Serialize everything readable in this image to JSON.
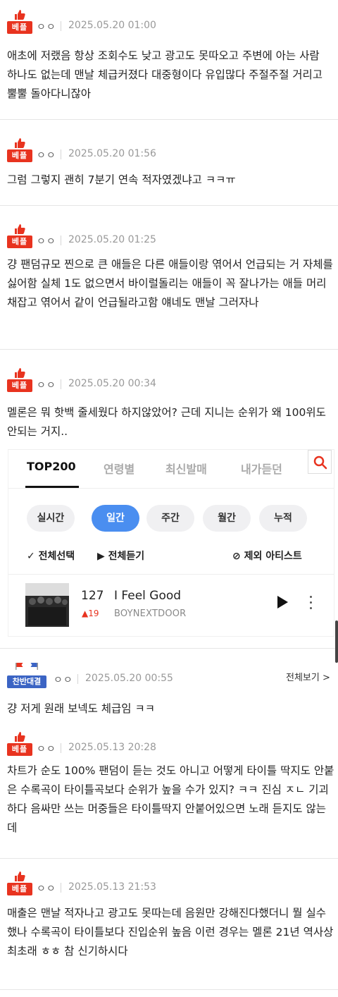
{
  "badges": {
    "best": "베플",
    "debate": "찬반대결"
  },
  "comments": [
    {
      "author": "ㅇㅇ",
      "date": "2025.05.20 01:00",
      "text": "애초에 저랬음 항상 조회수도 낮고 광고도 못따오고 주변에 아는 사람 하나도 없는데 맨날 체급커졌다 대중형이다 유입많다 주절주절 거리고 뿔뿔 돌아다니잖아"
    },
    {
      "author": "ㅇㅇ",
      "date": "2025.05.20 01:56",
      "text": "그럼 그렇지 괜히 7분기 연속 적자였겠냐고 ㅋㅋㅠ"
    },
    {
      "author": "ㅇㅇ",
      "date": "2025.05.20 01:25",
      "text": "걍 팬덤규모 찐으로 큰 애들은 다른 애들이랑 엮어서 언급되는 거 자체를 싫어함 실체 1도 없으면서 바이럴돌리는 애들이 꼭 잘나가는 애들 머리채잡고 엮어서 같이 언급될라고함 얘네도 맨날 그러자나"
    },
    {
      "author": "ㅇㅇ",
      "date": "2025.05.20 00:34",
      "text": "멜론은 뭐 핫백 줄세웠다 하지않았어? 근데 지니는 순위가 왜 100위도 안되는 거지.."
    },
    {
      "author": "ㅇㅇ",
      "date": "2025.05.20 00:55",
      "text": "걍 저게 원래 보넥도 체급임 ㅋㅋ"
    },
    {
      "author": "ㅇㅇ",
      "date": "2025.05.13 20:28",
      "text": "차트가 순도 100% 팬덤이 듣는 것도 아니고 어떻게 타이틀 딱지도 안붙은 수록곡이 타이틀곡보다 순위가 높을 수가 있지? ㅋㅋ 진심 ㅈㄴ 기괴하다 음싸만 쓰는 머중들은 타이틀딱지 안붙어있으면 노래 듣지도 않는데"
    },
    {
      "author": "ㅇㅇ",
      "date": "2025.05.13 21:53",
      "text": "매출은 맨날 적자나고 광고도 못따는데 음원만 강해진다했더니 뭘 실수했나 수록곡이 타이틀보다 진입순위 높음 이런 경우는 멜론 21년 역사상 최초래 ㅎㅎ 참 신기하시다"
    }
  ],
  "view_all": "전체보기 >",
  "melon": {
    "tabs": [
      "TOP200",
      "연령별",
      "최신발매",
      "내가듣던"
    ],
    "periods": [
      "실시간",
      "일간",
      "주간",
      "월간",
      "누적"
    ],
    "actions": {
      "select_all": "✓ 전체선택",
      "play_all": "▶ 전체듣기",
      "exclude": "⊘ 제외 아티스트"
    },
    "song": {
      "rank": "127",
      "change": "▲19",
      "title": "I Feel Good",
      "artist": "BOYNEXTDOOR"
    }
  },
  "colors": {
    "best_badge": "#e8331f",
    "debate_badge": "#3b64c4",
    "melon_active": "#4a8ef0"
  }
}
